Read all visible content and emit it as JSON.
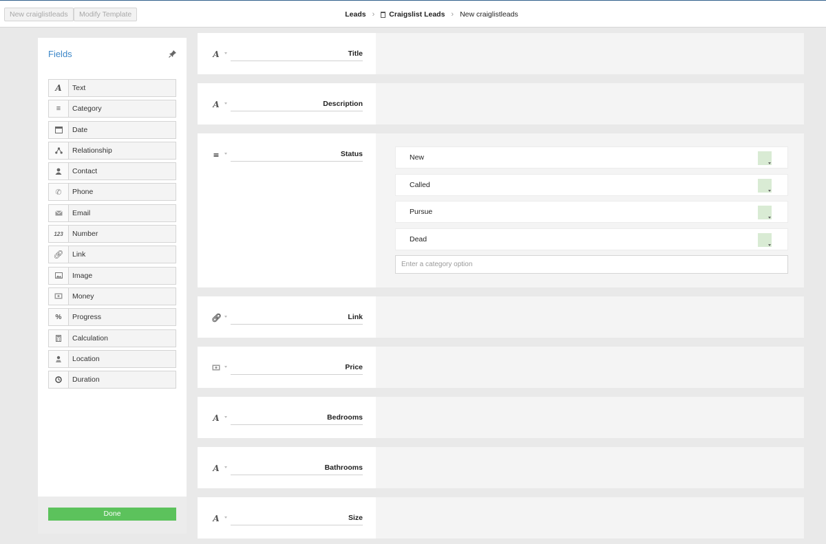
{
  "topbar": {
    "new_item_button": "New craiglistleads",
    "modify_template_button": "Modify Template",
    "breadcrumb": [
      "Leads",
      "Craigslist Leads",
      "New craiglistleads"
    ]
  },
  "fields_panel": {
    "title": "Fields",
    "items": [
      {
        "label": "Text",
        "icon": "text-icon"
      },
      {
        "label": "Category",
        "icon": "category-icon"
      },
      {
        "label": "Date",
        "icon": "calendar-icon"
      },
      {
        "label": "Relationship",
        "icon": "relationship-icon"
      },
      {
        "label": "Contact",
        "icon": "contact-icon"
      },
      {
        "label": "Phone",
        "icon": "phone-icon"
      },
      {
        "label": "Email",
        "icon": "email-icon"
      },
      {
        "label": "Number",
        "icon": "number-icon"
      },
      {
        "label": "Link",
        "icon": "link-icon"
      },
      {
        "label": "Image",
        "icon": "image-icon"
      },
      {
        "label": "Money",
        "icon": "money-icon"
      },
      {
        "label": "Progress",
        "icon": "progress-icon"
      },
      {
        "label": "Calculation",
        "icon": "calculation-icon"
      },
      {
        "label": "Location",
        "icon": "location-icon"
      },
      {
        "label": "Duration",
        "icon": "duration-icon"
      }
    ],
    "done_button": "Done"
  },
  "form_fields": [
    {
      "label": "Title",
      "icon": "text-icon"
    },
    {
      "label": "Description",
      "icon": "text-icon"
    },
    {
      "label": "Status",
      "icon": "category-icon"
    },
    {
      "label": "Link",
      "icon": "link-icon"
    },
    {
      "label": "Price",
      "icon": "money-icon"
    },
    {
      "label": "Bedrooms",
      "icon": "text-icon"
    },
    {
      "label": "Bathrooms",
      "icon": "text-icon"
    },
    {
      "label": "Size",
      "icon": "text-icon"
    }
  ],
  "status_options": [
    "New",
    "Called",
    "Pursue",
    "Dead"
  ],
  "category_option_placeholder": "Enter a category option",
  "colors": {
    "accent": "#3b86c8",
    "done_green": "#5cc25c",
    "option_swatch": "#d9ebd4"
  }
}
